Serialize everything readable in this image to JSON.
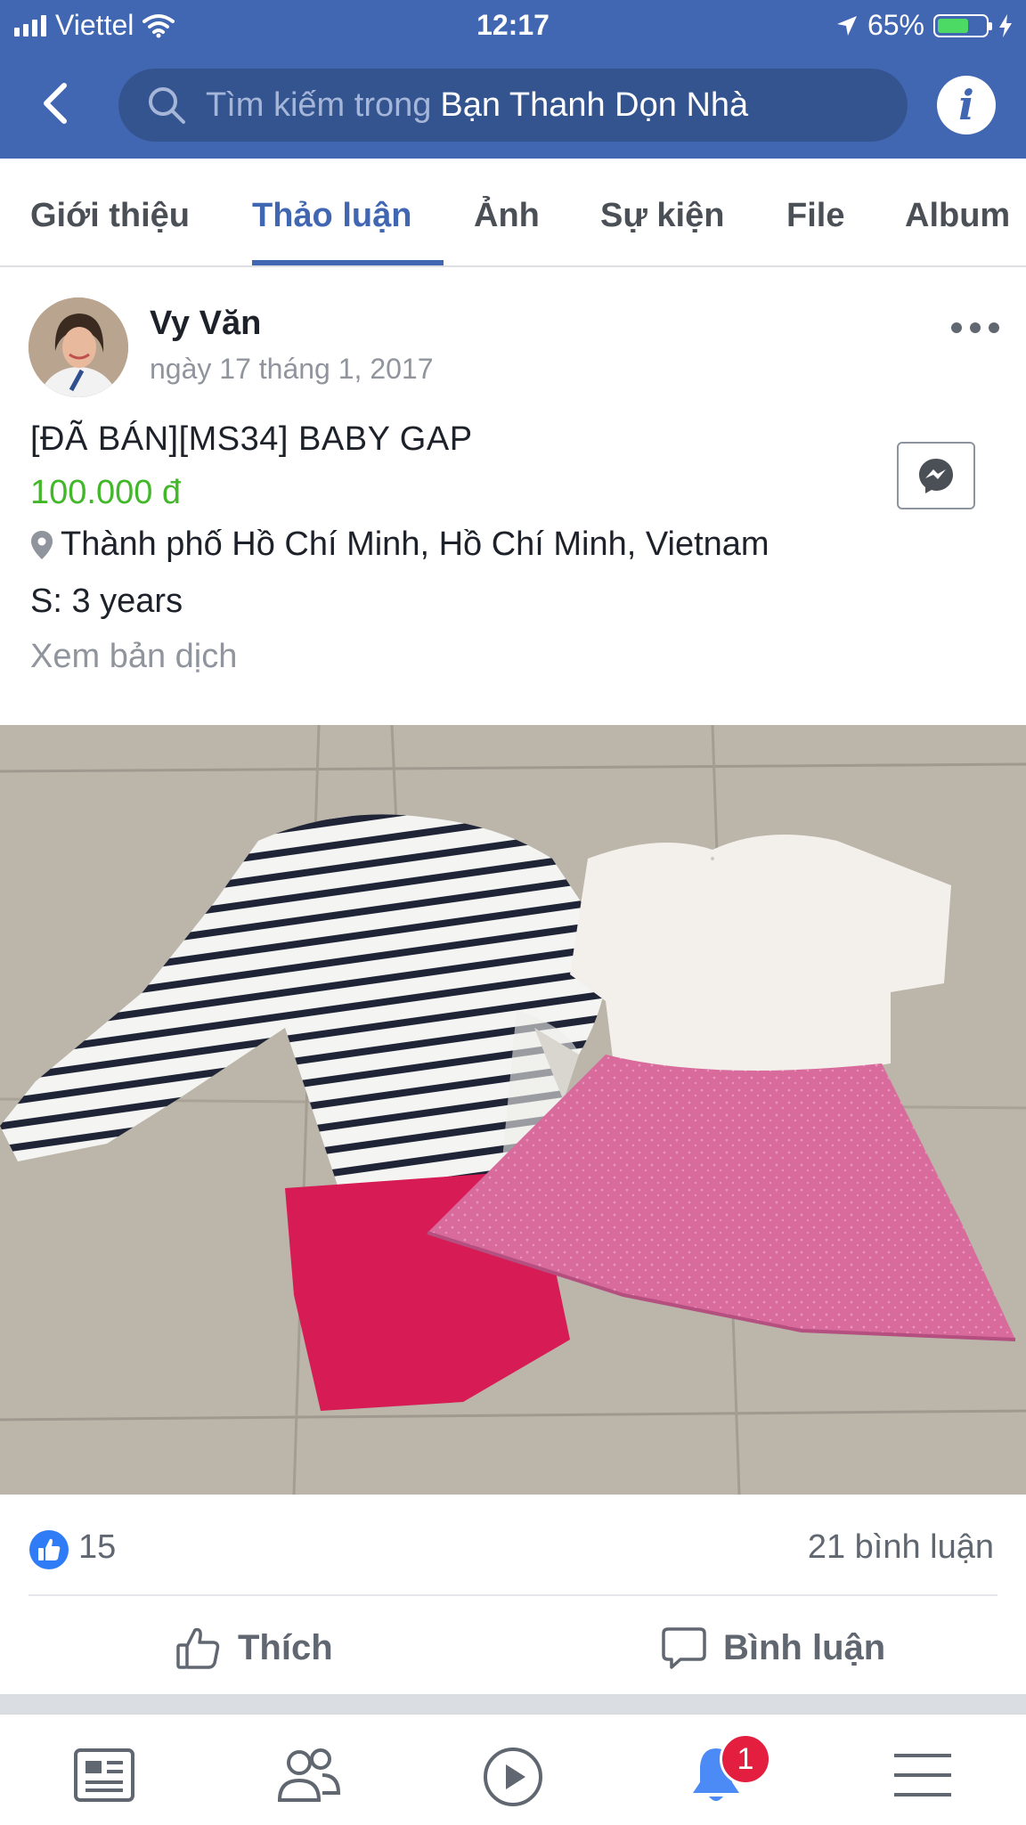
{
  "status_bar": {
    "carrier": "Viettel",
    "time": "12:17",
    "battery": "65%",
    "battery_level": 0.65
  },
  "search": {
    "hint": "Tìm kiếm trong",
    "group_name": "Bạn Thanh Dọn Nhà"
  },
  "tabs": [
    {
      "label": "Giới thiệu",
      "active": false
    },
    {
      "label": "Thảo luận",
      "active": true
    },
    {
      "label": "Ảnh",
      "active": false
    },
    {
      "label": "Sự kiện",
      "active": false
    },
    {
      "label": "File",
      "active": false
    },
    {
      "label": "Album",
      "active": false
    }
  ],
  "post": {
    "author": "Vy Văn",
    "date": "ngày 17 tháng 1, 2017",
    "title": "[ĐÃ BÁN][MS34] BABY GAP",
    "price": "100.000 đ",
    "location": "Thành phố Hồ Chí Minh, Hồ Chí Minh, Vietnam",
    "size": "S: 3 years",
    "translate": "Xem bản dịch",
    "likes": "15",
    "comments": "21 bình luận"
  },
  "actions": {
    "like": "Thích",
    "comment": "Bình luận"
  },
  "bottom_nav": {
    "notifications_badge": "1",
    "items": [
      "news-feed-icon",
      "friends-icon",
      "video-icon",
      "notifications-icon",
      "menu-icon"
    ]
  },
  "colors": {
    "brand_blue": "#4267b2",
    "price_green": "#42b72a",
    "badge_red": "#e41e3f"
  }
}
